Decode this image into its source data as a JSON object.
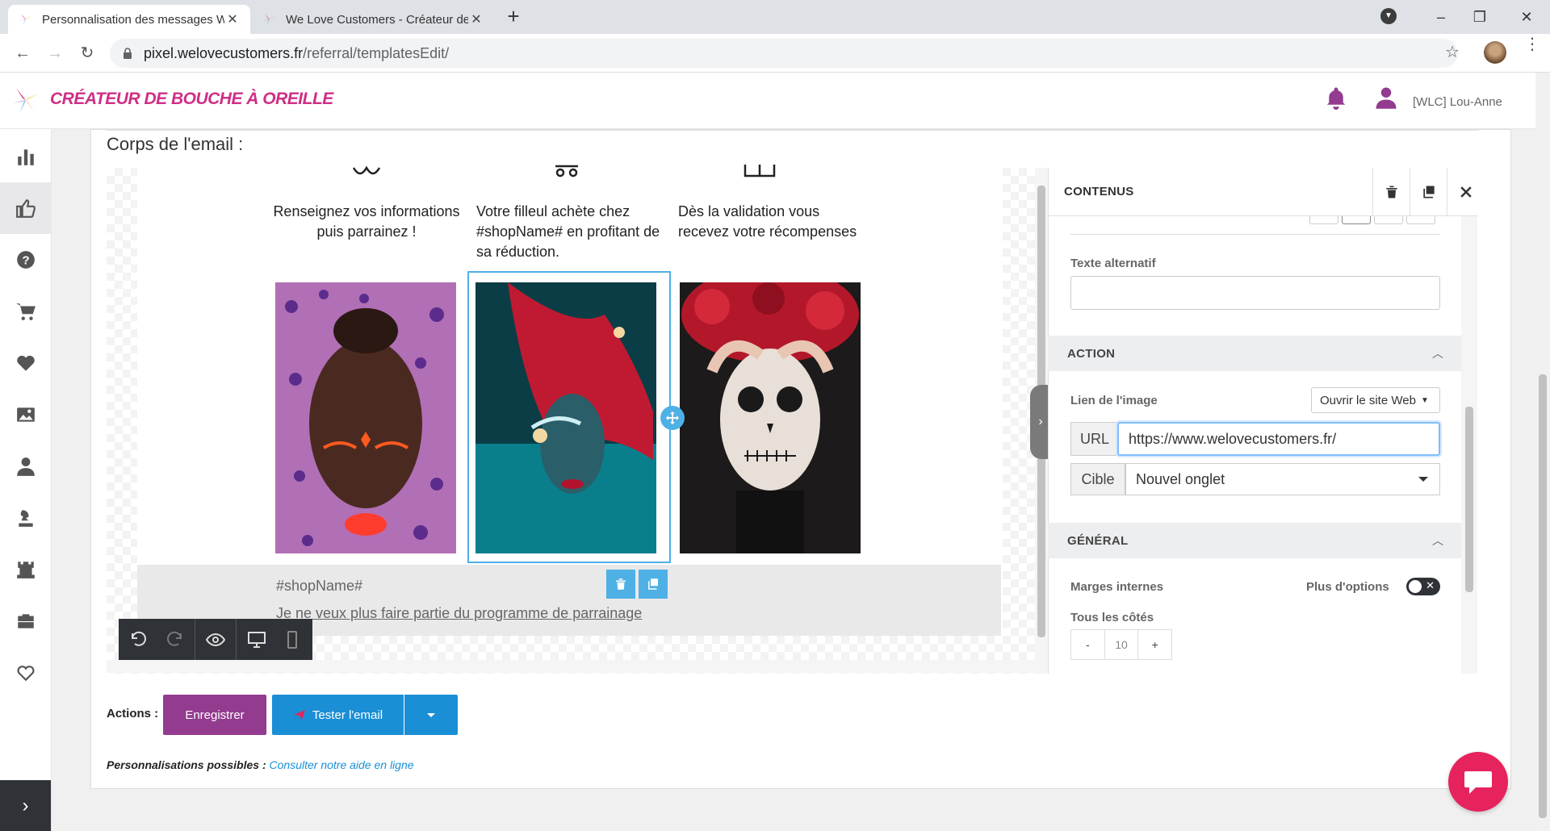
{
  "browser": {
    "tabs": [
      {
        "title": "Personnalisation des messages W",
        "active": true
      },
      {
        "title": "We Love Customers - Créateur de",
        "active": false
      }
    ],
    "url_host": "pixel.welovecustomers.fr",
    "url_path": "/referral/templatesEdit/"
  },
  "app": {
    "brand": "CRÉATEUR DE BOUCHE À OREILLE",
    "user_name": "[WLC] Lou-Anne",
    "brand_color": "#cf2e86"
  },
  "sidebar": {
    "items": [
      {
        "icon": "bar-chart-icon"
      },
      {
        "icon": "thumbs-up-icon",
        "active": true
      },
      {
        "icon": "question-icon"
      },
      {
        "icon": "cart-icon"
      },
      {
        "icon": "heart-icon"
      },
      {
        "icon": "image-icon"
      },
      {
        "icon": "user-icon"
      },
      {
        "icon": "chess-piece-icon"
      },
      {
        "icon": "castle-icon"
      },
      {
        "icon": "briefcase-icon"
      },
      {
        "icon": "heart-outline-icon"
      }
    ]
  },
  "editor": {
    "section_label": "Corps de l'email :",
    "steps": [
      {
        "text": "Renseignez vos informations puis parrainez !"
      },
      {
        "text": "Votre filleul achète chez #shopName# en profitant de sa réduction."
      },
      {
        "text": "Dès la validation vous recevez votre récompenses"
      }
    ],
    "shop_name": "#shopName#",
    "unsubscribe": "Je ne veux plus faire partie du programme de parrainage"
  },
  "panel": {
    "title": "CONTENUS",
    "alt_text_label": "Texte alternatif",
    "alt_text_value": "",
    "action_title": "ACTION",
    "image_link_label": "Lien de l'image",
    "image_link_option": "Ouvrir le site Web",
    "url_addon": "URL",
    "url_value": "https://www.welovecustomers.fr/",
    "target_addon": "Cible",
    "target_value": "Nouvel onglet",
    "general_title": "GÉNÉRAL",
    "padding_label": "Marges internes",
    "more_options_label": "Plus d'options",
    "all_sides_label": "Tous les côtés",
    "padding_minus": "-",
    "padding_value": "10",
    "padding_plus": "+"
  },
  "actions": {
    "label": "Actions :",
    "save": "Enregistrer",
    "test": "Tester l'email",
    "save_color": "#933b8f",
    "test_color": "#1a8fd6"
  },
  "help": {
    "label": "Personnalisations possibles :",
    "link": "Consulter notre aide en ligne"
  }
}
